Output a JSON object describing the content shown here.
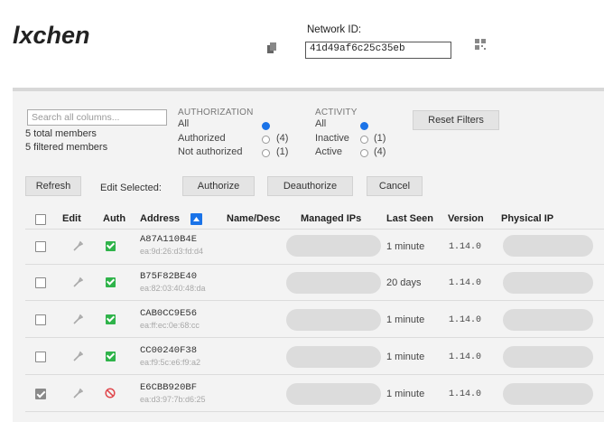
{
  "app": {
    "title": "lxchen"
  },
  "network": {
    "label": "Network ID:",
    "id": "41d49af6c25c35eb"
  },
  "search": {
    "placeholder": "Search all columns..."
  },
  "counts": {
    "total": "5 total members",
    "filtered": "5 filtered members"
  },
  "authorization_filter": {
    "header": "AUTHORIZATION",
    "options": [
      {
        "label": "All",
        "count": "",
        "selected": true
      },
      {
        "label": "Authorized",
        "count": "(4)",
        "selected": false
      },
      {
        "label": "Not authorized",
        "count": "(1)",
        "selected": false
      }
    ]
  },
  "activity_filter": {
    "header": "ACTIVITY",
    "options": [
      {
        "label": "All",
        "count": "",
        "selected": true
      },
      {
        "label": "Inactive",
        "count": "(1)",
        "selected": false
      },
      {
        "label": "Active",
        "count": "(4)",
        "selected": false
      }
    ]
  },
  "toolbar": {
    "reset": "Reset Filters",
    "refresh": "Refresh",
    "edit_selected": "Edit Selected:",
    "authorize": "Authorize",
    "deauthorize": "Deauthorize",
    "cancel": "Cancel"
  },
  "columns": {
    "edit": "Edit",
    "auth": "Auth",
    "address": "Address",
    "name": "Name/Desc",
    "managed_ips": "Managed IPs",
    "last_seen": "Last Seen",
    "version": "Version",
    "physical_ip": "Physical IP"
  },
  "members": [
    {
      "address": "A87A110B4E",
      "mac": "ea:9d:26:d3:fd:d4",
      "authorized": true,
      "selected": false,
      "last_seen": "1 minute",
      "version": "1.14.0"
    },
    {
      "address": "B75F82BE40",
      "mac": "ea:82:03:40:48:da",
      "authorized": true,
      "selected": false,
      "last_seen": "20 days",
      "version": "1.14.0"
    },
    {
      "address": "CAB0CC9E56",
      "mac": "ea:ff:ec:0e:68:cc",
      "authorized": true,
      "selected": false,
      "last_seen": "1 minute",
      "version": "1.14.0"
    },
    {
      "address": "CC00240F38",
      "mac": "ea:f9:5c:e6:f9:a2",
      "authorized": true,
      "selected": false,
      "last_seen": "1 minute",
      "version": "1.14.0"
    },
    {
      "address": "E6CBB920BF",
      "mac": "ea:d3:97:7b:d6:25",
      "authorized": false,
      "selected": true,
      "last_seen": "1 minute",
      "version": "1.14.0"
    }
  ],
  "colors": {
    "accent": "#1a73e8",
    "auth_ok": "#2fb34a",
    "auth_no": "#e0474c"
  }
}
